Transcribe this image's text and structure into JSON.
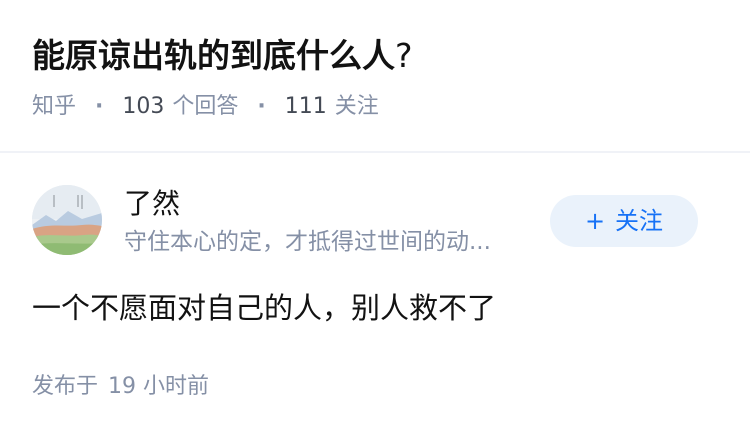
{
  "question": {
    "title": "能原谅出轨的到底什么人",
    "title_mark": "?",
    "source": "知乎",
    "separator": "·",
    "answer_count": "103",
    "answer_label": "个回答",
    "follower_count": "111",
    "follower_label": "关注"
  },
  "author": {
    "name": "了然",
    "bio": "守住本心的定，才抵得过世间的动...",
    "avatar_icon": "landscape-avatar-icon"
  },
  "follow_button": {
    "icon": "+",
    "label": "关注"
  },
  "answer": {
    "content": "一个不愿面对自己的人，别人救不了",
    "time_label": "发布于",
    "time_value": "19 小时前"
  },
  "colors": {
    "accent": "#1772f6",
    "button_bg": "#eaf2fb",
    "meta_text": "#8590a6",
    "divider": "#f0f2f7"
  }
}
